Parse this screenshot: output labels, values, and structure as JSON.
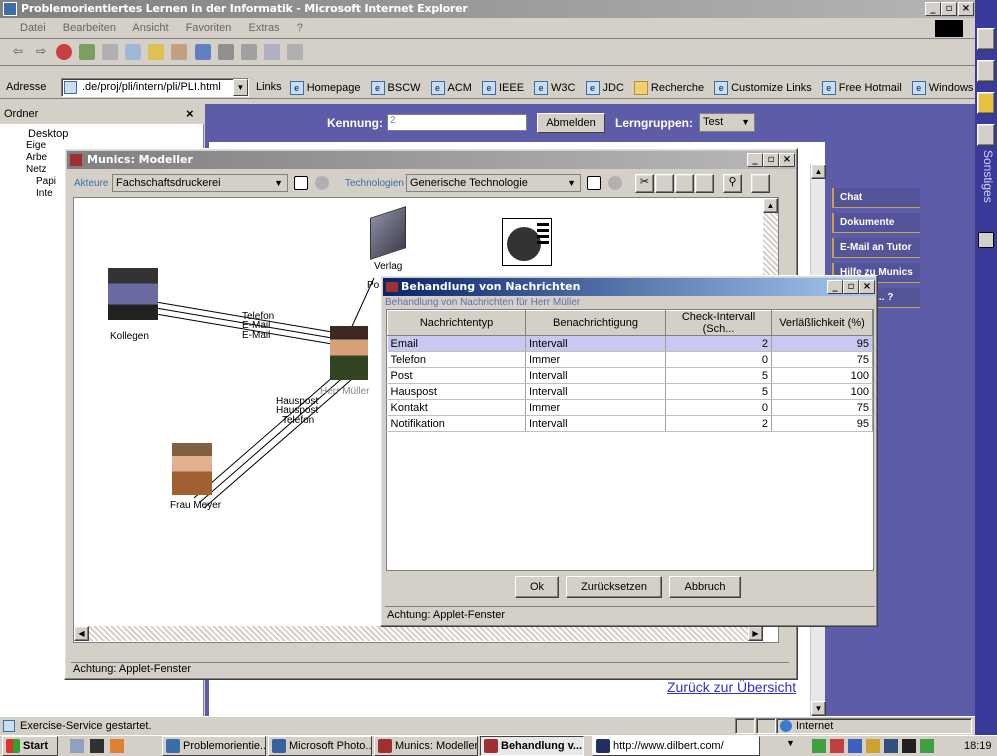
{
  "window": {
    "title": "Problemorientiertes Lernen in der Informatik - Microsoft Internet Explorer"
  },
  "menu": [
    "Datei",
    "Bearbeiten",
    "Ansicht",
    "Favoriten",
    "Extras",
    "?"
  ],
  "addressbar": {
    "label": "Adresse",
    "url": ".de/proj/pli/intern/pli/PLI.html"
  },
  "links": {
    "label": "Links",
    "items": [
      "Homepage",
      "BSCW",
      "ACM",
      "IEEE",
      "W3C",
      "JDC",
      "Recherche",
      "Customize Links",
      "Free Hotmail",
      "Windows"
    ]
  },
  "folders": {
    "title": "Ordner",
    "items": [
      "Desktop",
      "Eige",
      "Arbe",
      "Netz",
      "Papi",
      "Inte"
    ]
  },
  "page": {
    "kennung_label": "Kennung:",
    "kennung_value": "2",
    "abmelden": "Abmelden",
    "lerngruppen_label": "Lerngruppen:",
    "lerngruppen_value": "Test",
    "back_link": "Zurück zur Übersicht"
  },
  "sidenav": {
    "items": [
      "Chat",
      "Dokumente",
      "E-Mail an Tutor",
      "Hilfe zu Munics",
      "Fragen ... ?"
    ],
    "vertical_tab": "Sonstiges"
  },
  "modeller": {
    "title": "Munics: Modeller",
    "akteure_label": "Akteure",
    "akteure_value": "Fachschaftsdruckerei",
    "tech_label": "Technologien",
    "tech_value": "Generische Technologie",
    "status": "Achtung: Applet-Fenster"
  },
  "diagram": {
    "nodes": [
      "Verlag",
      "Po",
      "Kollegen",
      "Herr Müller",
      "Frau Meyer",
      "Hä"
    ],
    "edge_labels": [
      "Telefon",
      "E-Mail",
      "E-Mail",
      "Hauspost",
      "Hauspost",
      "Telefon"
    ]
  },
  "dialog": {
    "title": "Behandlung von Nachrichten",
    "subtitle": "Behandlung von Nachrichten für Herr Müller",
    "columns": [
      "Nachrichtentyp",
      "Benachrichtigung",
      "Check-Intervall (Sch...",
      "Verläßlichkeit (%)"
    ],
    "rows": [
      {
        "typ": "Email",
        "benachrichtigung": "Intervall",
        "intervall": "2",
        "verl": "95"
      },
      {
        "typ": "Telefon",
        "benachrichtigung": "Immer",
        "intervall": "0",
        "verl": "75"
      },
      {
        "typ": "Post",
        "benachrichtigung": "Intervall",
        "intervall": "5",
        "verl": "100"
      },
      {
        "typ": "Hauspost",
        "benachrichtigung": "Intervall",
        "intervall": "5",
        "verl": "100"
      },
      {
        "typ": "Kontakt",
        "benachrichtigung": "Immer",
        "intervall": "0",
        "verl": "75"
      },
      {
        "typ": "Notifikation",
        "benachrichtigung": "Intervall",
        "intervall": "2",
        "verl": "95"
      }
    ],
    "ok": "Ok",
    "reset": "Zurücksetzen",
    "cancel": "Abbruch",
    "status": "Achtung: Applet-Fenster"
  },
  "statusbar": {
    "text": "Exercise-Service gestartet.",
    "zone": "Internet"
  },
  "taskbar": {
    "start": "Start",
    "tasks": [
      "Problemorientie...",
      "Microsoft Photo...",
      "Munics: Modeller",
      "Behandlung v...",
      "http://www.dilbert.com/"
    ],
    "clock": "18:19"
  },
  "colors": {
    "title_active": "#0a246a",
    "title_inactive": "#808080",
    "page_band": "#5c5ca8",
    "dialog_selection": "#c8c8f0"
  }
}
